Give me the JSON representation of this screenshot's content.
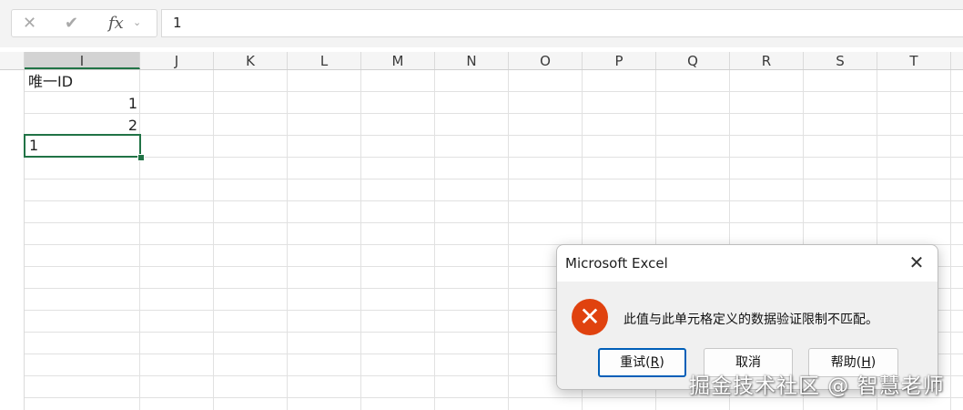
{
  "formula_bar": {
    "cancel_icon": "close-icon",
    "enter_icon": "check-icon",
    "fx_label": "fx",
    "formula_value": "1"
  },
  "columns": [
    "I",
    "J",
    "K",
    "L",
    "M",
    "N",
    "O",
    "P",
    "Q",
    "R",
    "S",
    "T"
  ],
  "selected_column": "I",
  "cells": {
    "i1": "唯一ID",
    "i2": "1",
    "i3": "2",
    "i4": "1"
  },
  "dialog": {
    "title": "Microsoft Excel",
    "message": "此值与此单元格定义的数据验证限制不匹配。",
    "retry_label": "重试(",
    "retry_key": "R",
    "cancel_label": "取消",
    "help_label": "帮助(",
    "help_key": "H",
    "close_glyph": "✕",
    "error_glyph": "✕"
  },
  "watermark": "掘金技术社区 @ 智慧老师",
  "colors": {
    "accent": "#217346",
    "error": "#e0420f",
    "focus": "#005fb8"
  }
}
